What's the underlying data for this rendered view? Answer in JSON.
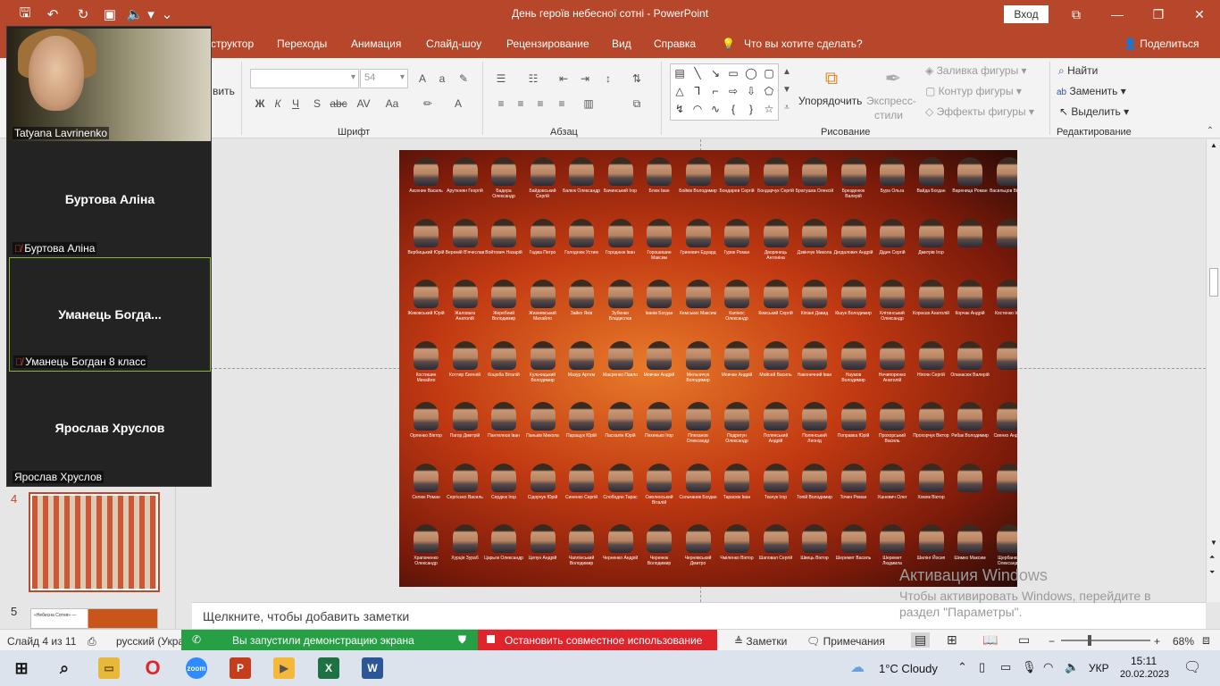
{
  "window": {
    "title": "День героїв небесної сотні  -  PowerPoint",
    "login_label": "Вход",
    "accent_color": "#b7472a"
  },
  "tabs": [
    "структор",
    "Переходы",
    "Анимация",
    "Слайд-шоу",
    "Рецензирование",
    "Вид",
    "Справка",
    "Что вы хотите сделать?"
  ],
  "share_label": "Поделиться",
  "ribbon": {
    "partial_label": "вить",
    "font_size": "54",
    "groups": {
      "font": "Шрифт",
      "paragraph": "Абзац",
      "drawing": "Рисование",
      "editing": "Редактирование"
    },
    "arrange": "Упорядочить",
    "express_styles_1": "Экспресс-",
    "express_styles_2": "стили",
    "fill": "Заливка фигуры",
    "outline": "Контур фигуры",
    "effects": "Эффекты фигуры",
    "find": "Найти",
    "replace": "Заменить",
    "select": "Выделить"
  },
  "zoom_panel": {
    "video_name": "Tatyana Lavrinenko",
    "participants": [
      {
        "display": "Буртова Аліна",
        "label": "Буртова Аліна",
        "muted": true,
        "active": false
      },
      {
        "display": "Уманець  Богда...",
        "label": "Уманець Богдан 8 класс",
        "muted": true,
        "active": true
      },
      {
        "display": "Ярослав Хруслов",
        "label": "Ярослав Хруслов",
        "muted": false,
        "active": false
      }
    ]
  },
  "slides": {
    "current": "4",
    "next": "5",
    "next_thumb_text": "«Небесна Сотня» —"
  },
  "slide_names": [
    [
      "Аксенин Василь",
      "Арутюнян Георгій",
      "Бадера Олександр",
      "Байдовський Сергій",
      "Балюк Олександр",
      "Бачинський Ігор",
      "Блюк Іван",
      "Бойків Володимир",
      "Бондарев Сергій",
      "Бондарчук Сергій",
      "Братушка Олексій",
      "Брезденюк Валерій",
      "Бура Ольга",
      "Вайда Богдан",
      "Вареница Роман",
      "Васильцов Віталій"
    ],
    [
      "Вербицький Юрій",
      "Веремій В'ячеслав",
      "Войтович Назарій",
      "Гаджа Петро",
      "Голоднюк Устим",
      "Городнюк Іван",
      "Горошишин Максим",
      "Гриневич Едуард",
      "Гурик Роман",
      "Дворянець Антоніна",
      "Дзвінчук Микола",
      "Дигдаловкч Андрій",
      "Дідич Сергій",
      "Дмитрів Ігор",
      "",
      ""
    ],
    [
      "Жиковський Юрій",
      "Жаловага Анатолій",
      "Жеребний Володимир",
      "Жизневський Михайло",
      "Зайко Яків",
      "Зубенко Владислав",
      "Іванів Богдан",
      "Кемських Максим",
      "Капінос Олександр",
      "Кемський Сергій",
      "Кіпіані Давид",
      "Кішук Володимир",
      "Клітинський Олександр",
      "Корнєєв Анатолій",
      "Корчак Андрій",
      "Костенко Ігор"
    ],
    [
      "Костишин Михайло",
      "Котляр Євгеній",
      "Коцюба Віталій",
      "Кульчицький Володимир",
      "Мазур Артем",
      "Маєренко Павло",
      "Мовчан Андрій",
      "Мельничук Володимир",
      "Мовчан Андрій",
      "Мойсей Василь",
      "Наконечний Іван",
      "Наумов Володимир",
      "Нечипоренко Анатолій",
      "Нігоян Сергій",
      "Опанасюк Валерій",
      ""
    ],
    [
      "Орленко Віктор",
      "Пагор Дмитрій",
      "Пантелеєв Іван",
      "Паньків Микола",
      "Паращук Юрій",
      "Пасхалін Юрій",
      "Пехенько Ігор",
      "Плеханов Олександр",
      "Подригун Олександр",
      "Полянський Андрій",
      "Полянський Леонід",
      "Поправка Юрій",
      "Прохорський Василь",
      "Прохорчук Віктор",
      "Рибак Володимир",
      "Свенко Андрій"
    ],
    [
      "Селюк Роман",
      "Сергієнко Василь",
      "Сердюк Ігор",
      "Сідорчук Юрій",
      "Синенко Сергій",
      "Слободян Тарас",
      "Смоленський Віталій",
      "Сольчаник Богдан",
      "Тарасюк Іван",
      "Ткачук Ігор",
      "Топій Володимир",
      "Точин Роман",
      "Ушневич Олег",
      "Хомяк Віктор",
      "",
      ""
    ],
    [
      "Храпаченко Олександр",
      "Хурція Зураб",
      "Царьок Олександр",
      "Цепун Андрій",
      "Чаплінський Володимир",
      "Черненко Андрій",
      "Черенюк Володимир",
      "Чернявський Дмитро",
      "Чміленко Віктор",
      "Шаповал Сергій",
      "Швець Віктор",
      "Шеремет Василь",
      "Шеремет Людмила",
      "Шилінг Йосип",
      "Шимко Максим",
      "Щербанюк Олександр"
    ]
  ],
  "notes_placeholder": "Щелкните, чтобы добавить заметки",
  "statusbar": {
    "slide_info": "Слайд 4 из 11",
    "language": "русский (Укра",
    "sharing": "Вы запустили демонстрацию экрана",
    "stop_sharing": "Остановить совместное использование",
    "notes": "Заметки",
    "comments": "Примечания",
    "zoom": "68%"
  },
  "watermark": {
    "line1": "Активация Windows",
    "line2": "Чтобы активировать Windows, перейдите в",
    "line3": "раздел \"Параметры\"."
  },
  "taskbar": {
    "weather": "1°C  Cloudy",
    "lang": "УКР",
    "time": "15:11",
    "date": "20.02.2023"
  }
}
